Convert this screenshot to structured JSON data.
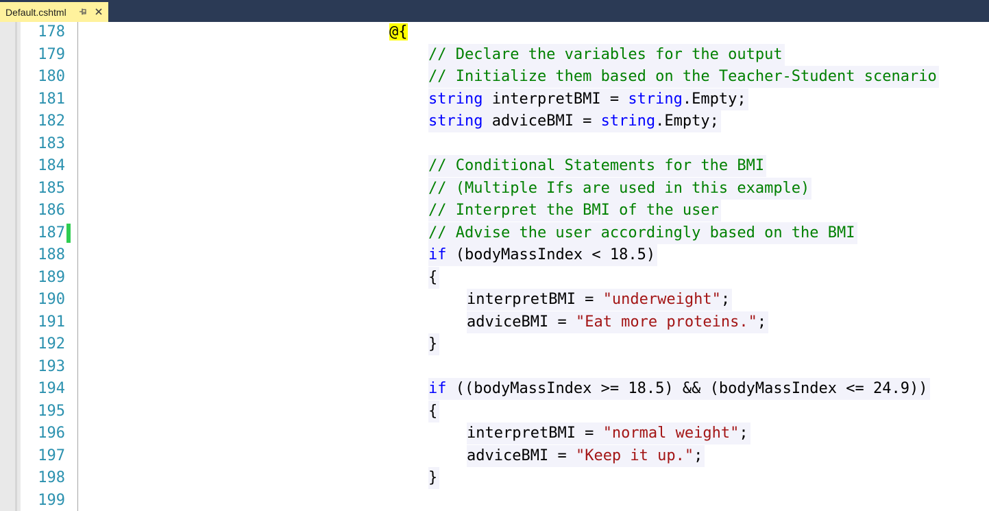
{
  "tab": {
    "title": "Default.cshtml",
    "pin_icon": "pin-icon",
    "close_icon": "close-icon"
  },
  "colors": {
    "tabstrip": "#2b3a55",
    "active_tab": "#fff29d",
    "line_number": "#2b91af",
    "keyword": "#0000ff",
    "comment": "#008000",
    "string": "#a31515",
    "razor_highlight": "#ffff00",
    "change_marker": "#2fcd51",
    "code_background": "#f3f3fb"
  },
  "editor": {
    "lines": [
      {
        "number": "178",
        "tokens": [
          {
            "t": "@{",
            "c": "razor"
          }
        ]
      },
      {
        "number": "179",
        "tokens": [
          {
            "t": "// Declare the variables for the output",
            "c": "cm"
          }
        ]
      },
      {
        "number": "180",
        "tokens": [
          {
            "t": "// Initialize them based on the Teacher-Student scenario",
            "c": "cm"
          }
        ]
      },
      {
        "number": "181",
        "tokens": [
          {
            "t": "string",
            "c": "kw"
          },
          {
            "t": " interpretBMI = ",
            "c": ""
          },
          {
            "t": "string",
            "c": "kw"
          },
          {
            "t": ".Empty;",
            "c": ""
          }
        ]
      },
      {
        "number": "182",
        "tokens": [
          {
            "t": "string",
            "c": "kw"
          },
          {
            "t": " adviceBMI = ",
            "c": ""
          },
          {
            "t": "string",
            "c": "kw"
          },
          {
            "t": ".Empty;",
            "c": ""
          }
        ]
      },
      {
        "number": "183",
        "tokens": []
      },
      {
        "number": "184",
        "tokens": [
          {
            "t": "// Conditional Statements for the BMI",
            "c": "cm"
          }
        ]
      },
      {
        "number": "185",
        "tokens": [
          {
            "t": "// (Multiple Ifs are used in this example)",
            "c": "cm"
          }
        ]
      },
      {
        "number": "186",
        "tokens": [
          {
            "t": "// Interpret the BMI of the user",
            "c": "cm"
          }
        ]
      },
      {
        "number": "187",
        "tokens": [
          {
            "t": "// Advise the user accordingly based on the BMI",
            "c": "cm"
          }
        ],
        "changed": true
      },
      {
        "number": "188",
        "tokens": [
          {
            "t": "if",
            "c": "kw"
          },
          {
            "t": " (bodyMassIndex < 18.5)",
            "c": ""
          }
        ]
      },
      {
        "number": "189",
        "tokens": [
          {
            "t": "{",
            "c": ""
          }
        ]
      },
      {
        "number": "190",
        "tokens": [
          {
            "t": "interpretBMI = ",
            "c": ""
          },
          {
            "t": "\"underweight\"",
            "c": "st"
          },
          {
            "t": ";",
            "c": ""
          }
        ]
      },
      {
        "number": "191",
        "tokens": [
          {
            "t": "adviceBMI = ",
            "c": ""
          },
          {
            "t": "\"Eat more proteins.\"",
            "c": "st"
          },
          {
            "t": ";",
            "c": ""
          }
        ]
      },
      {
        "number": "192",
        "tokens": [
          {
            "t": "}",
            "c": ""
          }
        ]
      },
      {
        "number": "193",
        "tokens": []
      },
      {
        "number": "194",
        "tokens": [
          {
            "t": "if",
            "c": "kw"
          },
          {
            "t": " ((bodyMassIndex >= 18.5) && (bodyMassIndex <= 24.9))",
            "c": ""
          }
        ]
      },
      {
        "number": "195",
        "tokens": [
          {
            "t": "{",
            "c": ""
          }
        ]
      },
      {
        "number": "196",
        "tokens": [
          {
            "t": "interpretBMI = ",
            "c": ""
          },
          {
            "t": "\"normal weight\"",
            "c": "st"
          },
          {
            "t": ";",
            "c": ""
          }
        ]
      },
      {
        "number": "197",
        "tokens": [
          {
            "t": "adviceBMI = ",
            "c": ""
          },
          {
            "t": "\"Keep it up.\"",
            "c": "st"
          },
          {
            "t": ";",
            "c": ""
          }
        ]
      },
      {
        "number": "198",
        "tokens": [
          {
            "t": "}",
            "c": ""
          }
        ]
      },
      {
        "number": "199",
        "tokens": []
      }
    ]
  }
}
